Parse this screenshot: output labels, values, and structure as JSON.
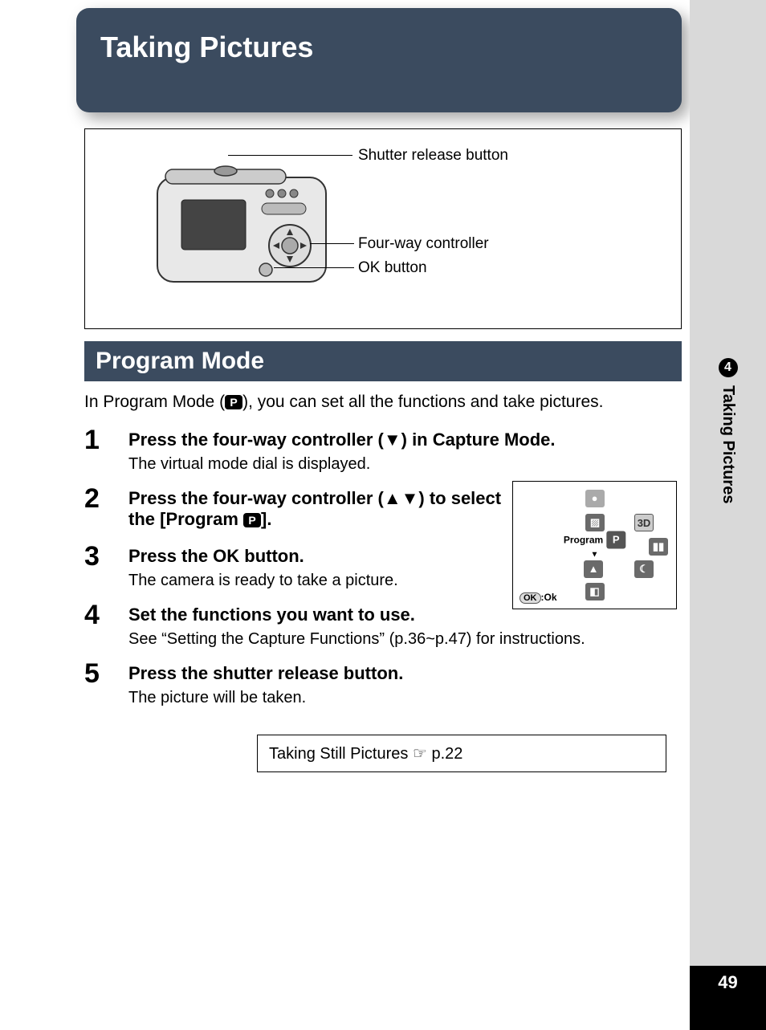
{
  "chapter_title": "Taking Pictures",
  "diagram": {
    "callouts": [
      {
        "label": "Shutter release button"
      },
      {
        "label": "Four-way controller"
      },
      {
        "label": "OK button"
      }
    ]
  },
  "section_title": "Program Mode",
  "intro_pre": "In Program Mode (",
  "intro_icon": "P",
  "intro_post": "), you can set all the functions and take pictures.",
  "steps": [
    {
      "num": "1",
      "title": "Press the four-way controller (▼) in Capture Mode.",
      "desc": "The virtual mode dial is displayed."
    },
    {
      "num": "2",
      "title_pre": "Press the four-way controller (▲▼) to select the [Program ",
      "title_icon": "P",
      "title_post": "].",
      "desc": ""
    },
    {
      "num": "3",
      "title": "Press the OK button.",
      "desc": "The camera is ready to take a picture."
    },
    {
      "num": "4",
      "title": "Set the functions you want to use.",
      "desc": "See “Setting the Capture Functions” (p.36~p.47) for instructions."
    },
    {
      "num": "5",
      "title": "Press the shutter release button.",
      "desc": "The picture will be taken."
    }
  ],
  "lcd": {
    "mode_label": "Program",
    "center_icon": "P",
    "ok_text": ":Ok",
    "ok_btn": "OK"
  },
  "footer_ref": "Taking Still Pictures ☞ p.22",
  "tab": {
    "number": "4",
    "text": "Taking Pictures"
  },
  "page_number": "49"
}
